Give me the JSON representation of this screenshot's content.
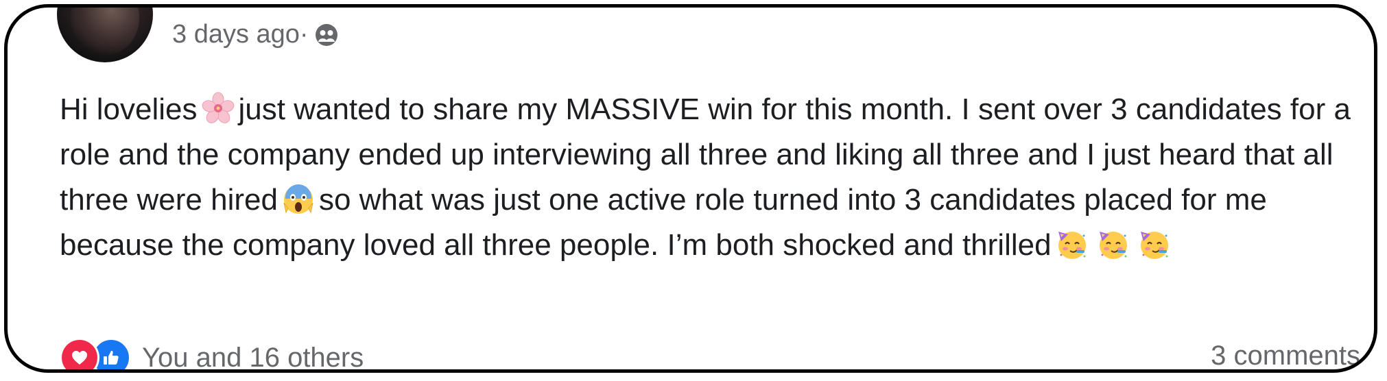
{
  "post": {
    "timestamp": "3 days ago",
    "separator": "·",
    "audience_icon": "friends-audience-icon",
    "text_segments": {
      "s1": "Hi lovelies",
      "s2": "just wanted to share my MASSIVE win for this month. I sent over 3 candidates for a role and the company ended up interviewing all three and liking all three and I just heard that all three were hired",
      "s3": "so what was just one active role turned into 3 candidates placed for me because the company loved all three people. I’m both shocked and thrilled"
    },
    "emojis": [
      "cherry-blossom-emoji",
      "face-screaming-in-fear-emoji",
      "partying-face-emoji",
      "partying-face-emoji",
      "partying-face-emoji"
    ]
  },
  "footer": {
    "reactions_text": "You and 16 others",
    "comments_text": "3 comments",
    "reaction_icons": [
      "love-reaction-icon",
      "like-reaction-icon"
    ]
  },
  "colors": {
    "text": "#1c1e21",
    "secondary_text": "#65676b",
    "love": "#f0284a",
    "like": "#1877f2"
  }
}
